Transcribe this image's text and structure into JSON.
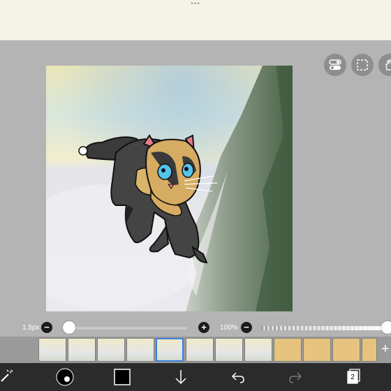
{
  "app": {
    "grabber": "•••"
  },
  "toolbar_right": [
    {
      "name": "toggle-switch-icon"
    },
    {
      "name": "selection-dashed-icon"
    },
    {
      "name": "hand-tool-icon"
    }
  ],
  "brush": {
    "size_label": "1.5px",
    "size_value_fraction": 0.0
  },
  "opacity": {
    "label": "100%",
    "value_fraction": 1.0
  },
  "frames": {
    "count": 12,
    "selected_index": 4,
    "add_label": "+"
  },
  "bottom_toolbar": {
    "layers_count": "2"
  },
  "colors": {
    "primary": "#000000",
    "selected_frame_border": "#3b7fd9",
    "ui_gray": "#b4b4b4",
    "bottom_bar": "#2b2b2b"
  }
}
